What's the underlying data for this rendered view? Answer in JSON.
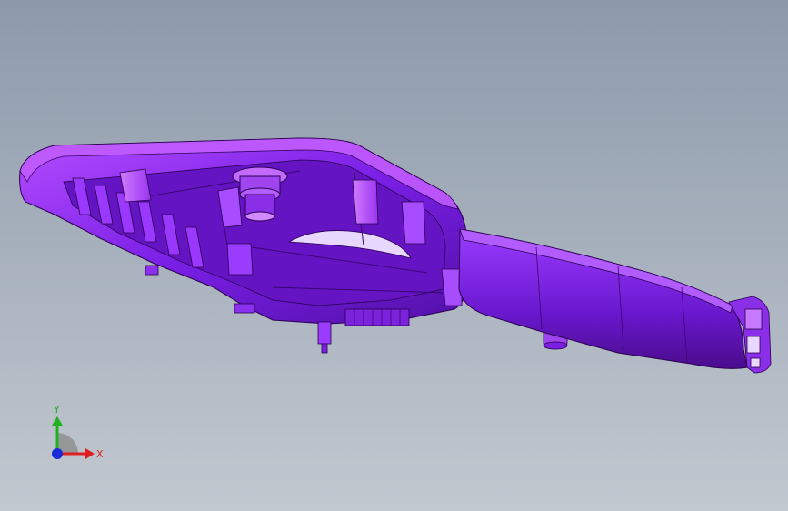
{
  "viewport": {
    "background_top": "#8d9aab",
    "background_bottom": "#c2c8d0"
  },
  "model": {
    "color_base": "#7a1fe6",
    "color_light": "#c24dff",
    "color_dark": "#4a0c8c",
    "color_edge": "#2a0050"
  },
  "triad": {
    "x_label": "X",
    "y_label": "Y",
    "x_color": "#e02020",
    "y_color": "#20b020",
    "z_color": "#1a2cd6"
  }
}
